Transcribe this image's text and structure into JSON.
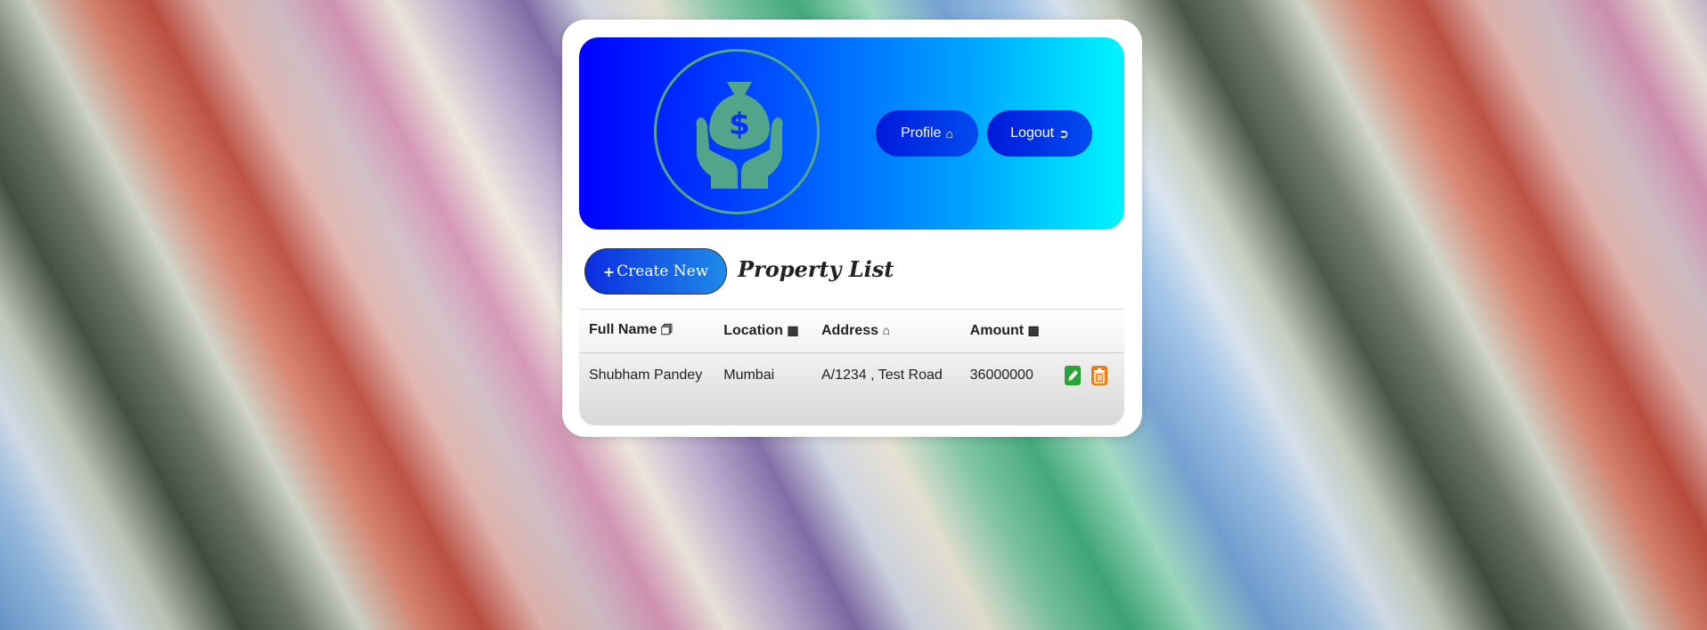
{
  "colors": {
    "banner_start": "#0000ff",
    "banner_end": "#00f6ff",
    "logo_teal": "#52a58a",
    "edit_green": "#29a33b",
    "delete_orange": "#f07d10"
  },
  "header": {
    "logo_icon": "money-bag-hands-icon",
    "profile_label": "Profile",
    "profile_icon": "home-icon",
    "logout_label": "Logout",
    "logout_icon": "sign-out-icon"
  },
  "main": {
    "create_label": "Create New",
    "create_icon": "plus-icon",
    "title": "Property List"
  },
  "table": {
    "headers": [
      {
        "label": "Full Name",
        "icon": "address-card-icon"
      },
      {
        "label": "Location",
        "icon": "map-icon"
      },
      {
        "label": "Address",
        "icon": "home-icon"
      },
      {
        "label": "Amount",
        "icon": "money-bill-icon"
      },
      {
        "label": "",
        "icon": ""
      }
    ],
    "rows": [
      {
        "full_name": "Shubham Pandey",
        "location": "Mumbai",
        "address": "A/1234 , Test Road",
        "amount": "36000000",
        "actions": [
          "edit-icon",
          "delete-icon"
        ]
      }
    ]
  }
}
